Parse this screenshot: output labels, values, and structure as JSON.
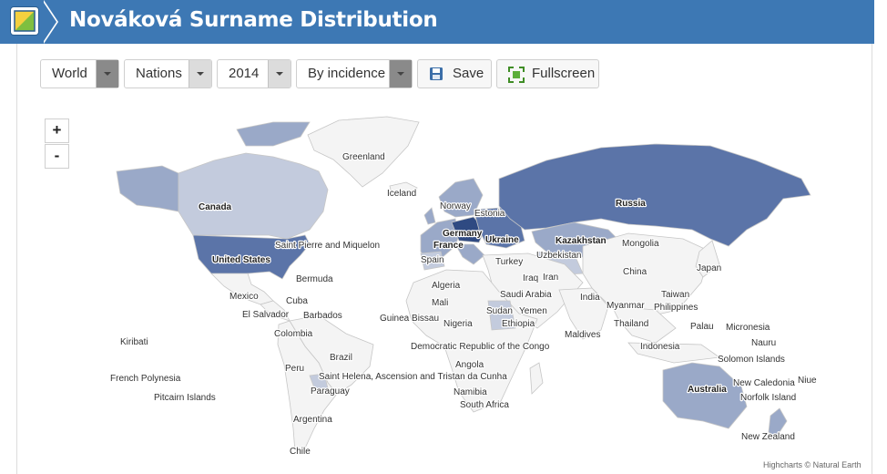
{
  "header": {
    "title": "Nováková Surname Distribution",
    "logo_icon": "map-logo-icon",
    "color": "#3d78b4"
  },
  "toolbar": {
    "region": "World",
    "level": "Nations",
    "year": "2014",
    "metric": "By incidence",
    "save_label": "Save",
    "fullscreen_label": "Fullscreen"
  },
  "zoom": {
    "in": "+",
    "out": "-"
  },
  "credit": "Highcharts © Natural Earth",
  "legend_colors": {
    "none": "#f4f4f4",
    "low": "#c3cbdd",
    "mid": "#9aa9c8",
    "high": "#5b74a8",
    "top": "#2f4a82"
  },
  "labels": [
    "Greenland",
    "Iceland",
    "Canada",
    "Norway",
    "Estonia",
    "Russia",
    "Germany",
    "Ukraine",
    "France",
    "Kazakhstan",
    "Mongolia",
    "Uzbekistan",
    "United States",
    "Saint Pierre and Miquelon",
    "Spain",
    "Turkey",
    "Iraq",
    "Iran",
    "China",
    "Japan",
    "Bermuda",
    "Algeria",
    "Saudi Arabia",
    "Mexico",
    "Cuba",
    "Mali",
    "Taiwan",
    "India",
    "Myanmar",
    "Philippines",
    "El Salvador",
    "Barbados",
    "Guinea Bissau",
    "Sudan",
    "Yemen",
    "Nigeria",
    "Ethiopia",
    "Thailand",
    "Palau",
    "Micronesia",
    "Colombia",
    "Maldives",
    "Kiribati",
    "Nauru",
    "Democratic Republic of the Congo",
    "Indonesia",
    "Brazil",
    "Solomon Islands",
    "Angola",
    "French Polynesia",
    "Peru",
    "Saint Helena, Ascension and Tristan da Cunha",
    "New Caledonia",
    "Niue",
    "Australia",
    "Namibia",
    "Norfolk Island",
    "Pitcairn Islands",
    "Paraguay",
    "South Africa",
    "Argentina",
    "New Zealand",
    "Chile"
  ]
}
